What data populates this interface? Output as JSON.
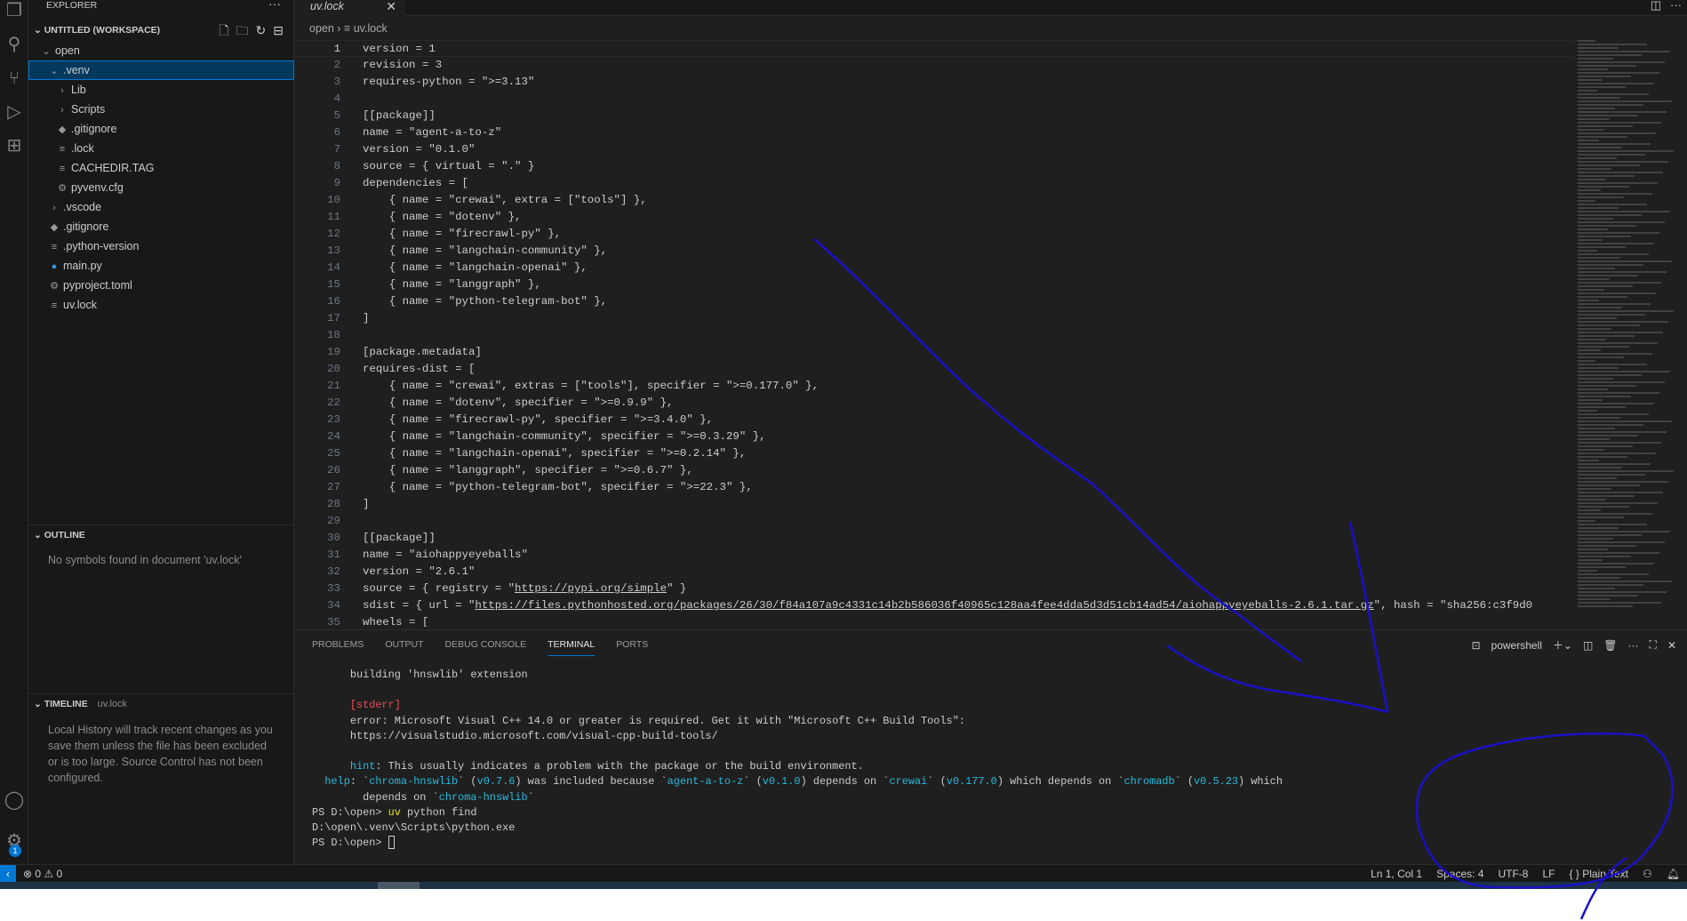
{
  "activity": {
    "badge": "1"
  },
  "sidebar": {
    "title": "EXPLORER",
    "more": "···",
    "workspace": "UNTITLED (WORKSPACE)",
    "tree": [
      {
        "label": "open",
        "icon": "chevron-down",
        "glyph": "⌄",
        "depth": 1
      },
      {
        "label": ".venv",
        "icon": "chevron-down",
        "glyph": "⌄",
        "depth": 2,
        "selected": true
      },
      {
        "label": "Lib",
        "icon": "chevron-right",
        "glyph": "›",
        "depth": 3
      },
      {
        "label": "Scripts",
        "icon": "chevron-right",
        "glyph": "›",
        "depth": 3
      },
      {
        "label": ".gitignore",
        "icon": "git-file",
        "glyph": "◆",
        "depth": 3
      },
      {
        "label": ".lock",
        "icon": "text-file",
        "glyph": "≡",
        "depth": 3
      },
      {
        "label": "CACHEDIR.TAG",
        "icon": "text-file",
        "glyph": "≡",
        "depth": 3
      },
      {
        "label": "pyvenv.cfg",
        "icon": "gear-file",
        "glyph": "⚙",
        "depth": 3
      },
      {
        "label": ".vscode",
        "icon": "chevron-right",
        "glyph": "›",
        "depth": 2
      },
      {
        "label": ".gitignore",
        "icon": "git-file",
        "glyph": "◆",
        "depth": 2
      },
      {
        "label": ".python-version",
        "icon": "text-file",
        "glyph": "≡",
        "depth": 2
      },
      {
        "label": "main.py",
        "icon": "python-file",
        "glyph": "●",
        "depth": 2
      },
      {
        "label": "pyproject.toml",
        "icon": "gear-file",
        "glyph": "⚙",
        "depth": 2
      },
      {
        "label": "uv.lock",
        "icon": "text-file",
        "glyph": "≡",
        "depth": 2
      }
    ],
    "outline": {
      "title": "OUTLINE",
      "message": "No symbols found in document 'uv.lock'"
    },
    "timeline": {
      "title": "TIMELINE",
      "file": "uv.lock",
      "message": "Local History will track recent changes as you save them unless the file has been excluded or is too large. Source Control has not been configured."
    }
  },
  "editor": {
    "tab": "uv.lock",
    "breadcrumb": [
      "open",
      "uv.lock"
    ],
    "current_line": 1,
    "lines": [
      "version = 1",
      "revision = 3",
      "requires-python = \">=3.13\"",
      "",
      "[[package]]",
      "name = \"agent-a-to-z\"",
      "version = \"0.1.0\"",
      "source = { virtual = \".\" }",
      "dependencies = [",
      "    { name = \"crewai\", extra = [\"tools\"] },",
      "    { name = \"dotenv\" },",
      "    { name = \"firecrawl-py\" },",
      "    { name = \"langchain-community\" },",
      "    { name = \"langchain-openai\" },",
      "    { name = \"langgraph\" },",
      "    { name = \"python-telegram-bot\" },",
      "]",
      "",
      "[package.metadata]",
      "requires-dist = [",
      "    { name = \"crewai\", extras = [\"tools\"], specifier = \">=0.177.0\" },",
      "    { name = \"dotenv\", specifier = \">=0.9.9\" },",
      "    { name = \"firecrawl-py\", specifier = \">=3.4.0\" },",
      "    { name = \"langchain-community\", specifier = \">=0.3.29\" },",
      "    { name = \"langchain-openai\", specifier = \">=0.2.14\" },",
      "    { name = \"langgraph\", specifier = \">=0.6.7\" },",
      "    { name = \"python-telegram-bot\", specifier = \">=22.3\" },",
      "]",
      "",
      "[[package]]",
      "name = \"aiohappyeyeballs\"",
      "version = \"2.6.1\"",
      "source = { registry = \"https://pypi.org/simple\" }",
      "sdist = { url = \"https://files.pythonhosted.org/packages/26/30/f84a107a9c4331c14b2b586036f40965c128aa4fee4dda5d3d51cb14ad54/aiohappyeyeballs-2.6.1.tar.gz\", hash = \"sha256:c3f9d0",
      "wheels = ["
    ]
  },
  "panel": {
    "tabs": [
      "PROBLEMS",
      "OUTPUT",
      "DEBUG CONSOLE",
      "TERMINAL",
      "PORTS"
    ],
    "active_tab": "TERMINAL",
    "shell": "powershell",
    "terminal": [
      [
        [
          "      building 'hnswlib' extension",
          ""
        ]
      ],
      [
        [
          "",
          ""
        ]
      ],
      [
        [
          "      ",
          ""
        ],
        [
          "[stderr]",
          "red"
        ]
      ],
      [
        [
          "      error: Microsoft Visual C++ 14.0 or greater is required. Get it with \"Microsoft C++ Build Tools\":",
          ""
        ]
      ],
      [
        [
          "      https://visualstudio.microsoft.com/visual-cpp-build-tools/",
          ""
        ]
      ],
      [
        [
          "",
          ""
        ]
      ],
      [
        [
          "      ",
          ""
        ],
        [
          "hint",
          "cyan"
        ],
        [
          ": This usually indicates a problem with the package or the build environment.",
          ""
        ]
      ],
      [
        [
          "  ",
          ""
        ],
        [
          "help",
          "cyan"
        ],
        [
          ": `",
          ""
        ],
        [
          "chroma-hnswlib",
          "cyan"
        ],
        [
          "` (",
          ""
        ],
        [
          "v0.7.6",
          "cyan"
        ],
        [
          ") was included because `",
          ""
        ],
        [
          "agent-a-to-z",
          "cyan"
        ],
        [
          "` (",
          ""
        ],
        [
          "v0.1.0",
          "cyan"
        ],
        [
          ") depends on `",
          ""
        ],
        [
          "crewai",
          "cyan"
        ],
        [
          "` (",
          ""
        ],
        [
          "v0.177.0",
          "cyan"
        ],
        [
          ") which depends on `",
          ""
        ],
        [
          "chromadb",
          "cyan"
        ],
        [
          "` (",
          ""
        ],
        [
          "v0.5.23",
          "cyan"
        ],
        [
          ") which",
          ""
        ]
      ],
      [
        [
          "        depends on `",
          ""
        ],
        [
          "chroma-hnswlib",
          "cyan"
        ],
        [
          "`",
          ""
        ]
      ],
      [
        [
          "PS D:\\open> ",
          ""
        ],
        [
          "uv",
          "yellow"
        ],
        [
          " python find",
          ""
        ]
      ],
      [
        [
          "D:\\open\\.venv\\Scripts\\python.exe",
          ""
        ]
      ],
      [
        [
          "PS D:\\open> ",
          ""
        ]
      ]
    ]
  },
  "status": {
    "errors": "0",
    "warnings": "0",
    "position": "Ln 1, Col 1",
    "spaces": "Spaces: 4",
    "encoding": "UTF-8",
    "eol": "LF",
    "language": "Plain Text"
  },
  "colors": {
    "accent": "#0078d4",
    "selection": "#04395e",
    "ink": "#1a10c8"
  }
}
